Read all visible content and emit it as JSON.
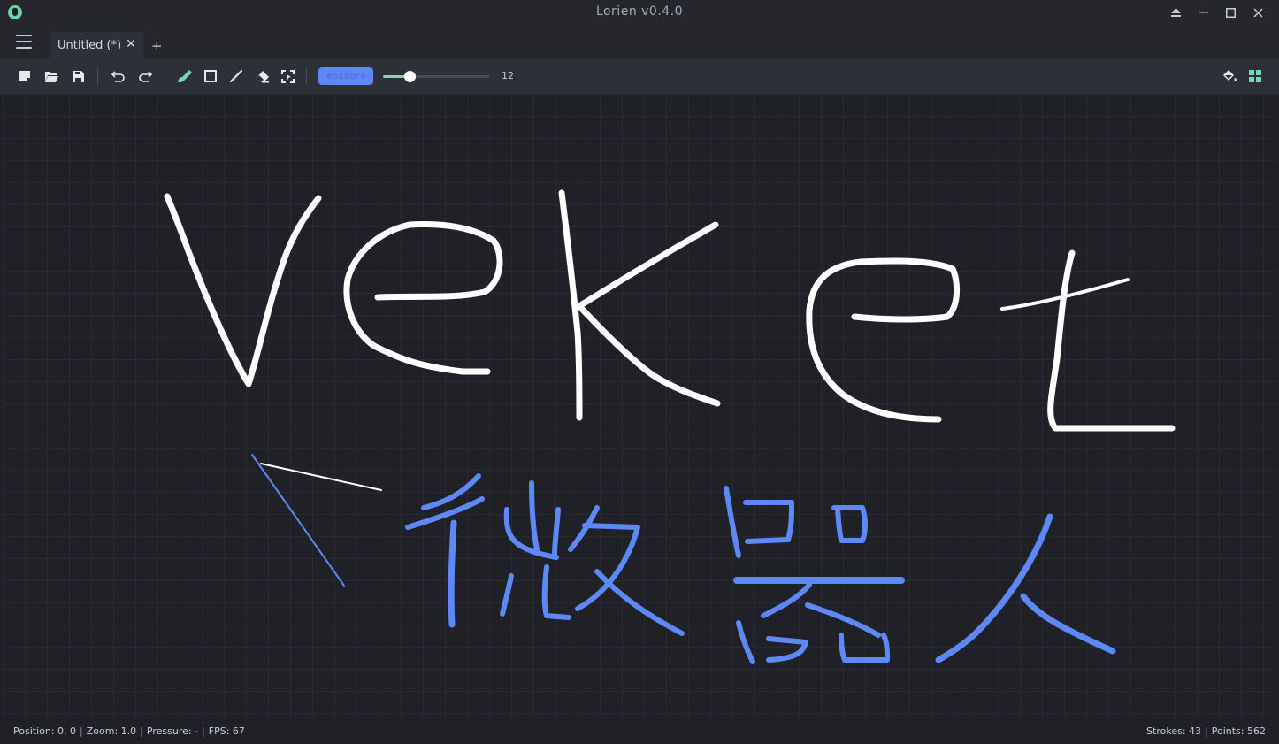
{
  "window": {
    "title": "Lorien v0.4.0",
    "controls": [
      "eject-icon",
      "minimize-icon",
      "maximize-icon",
      "close-icon"
    ]
  },
  "tabs": {
    "items": [
      {
        "label": "Untitled (*)",
        "active": true
      }
    ],
    "add_label": "+",
    "close_glyph": "✕"
  },
  "toolbar": {
    "file_tools": [
      "new-file-icon",
      "open-folder-icon",
      "save-icon"
    ],
    "history_tools": [
      "undo-icon",
      "redo-icon"
    ],
    "draw_tools": [
      "brush-icon",
      "rectangle-icon",
      "line-icon",
      "eraser-icon",
      "selection-icon"
    ],
    "active_tool": "brush-icon",
    "color_value": "#5E88F6",
    "brush_size": "12",
    "brush_size_fraction": 0.25,
    "right_tools": [
      "paint-bucket-icon",
      "grid-icon"
    ]
  },
  "canvas": {
    "background": "#1F2126",
    "stroke_colors": [
      "#FFFFFF",
      "#5E88F6"
    ]
  },
  "statusbar": {
    "position": "Position: 0, 0",
    "zoom": "Zoom: 1.0",
    "pressure": "Pressure: -",
    "fps": "FPS: 67",
    "strokes": "Strokes: 43",
    "points": "Points: 562"
  },
  "colors": {
    "accent": "#76D9B6",
    "color_button": "#5E88F6",
    "stroke_white": "#FFFFFF",
    "stroke_blue": "#5E88F6"
  }
}
